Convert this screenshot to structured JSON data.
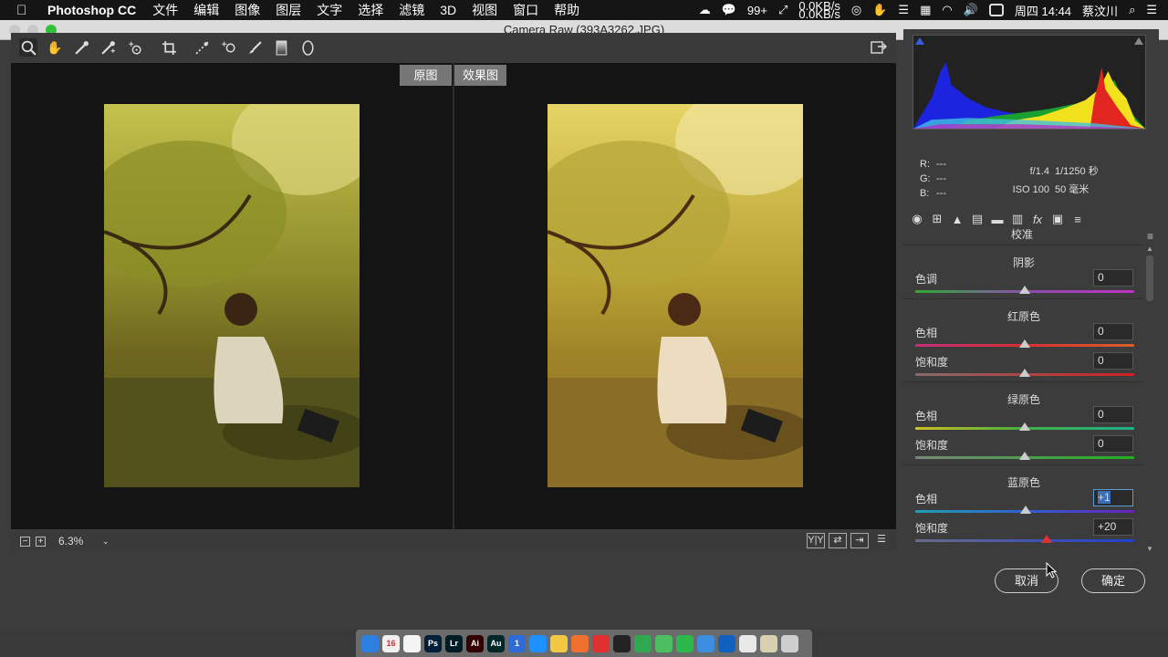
{
  "menubar": {
    "app_name": "Photoshop CC",
    "items": [
      "文件",
      "编辑",
      "图像",
      "图层",
      "文字",
      "选择",
      "滤镜",
      "3D",
      "视图",
      "窗口",
      "帮助"
    ],
    "notifications": "99+",
    "net_up": "0.0KB/s",
    "net_down": "0.0KB/s",
    "clock": "周四 14:44",
    "user": "蔡汶川"
  },
  "window": {
    "title": "Camera Raw (393A3262.JPG)"
  },
  "toolbar": {
    "tools": [
      "zoom-tool",
      "hand-tool",
      "white-balance-tool",
      "color-sampler-tool",
      "targeted-adjustment-tool",
      "crop-tool",
      "straighten-tool",
      "spot-removal-tool",
      "red-eye-tool",
      "adjustment-brush",
      "graduated-filter",
      "radial-filter"
    ]
  },
  "preview": {
    "before_label": "原图",
    "after_label": "效果图",
    "zoom": "6.3%"
  },
  "info": {
    "r_label": "R:",
    "r_value": "---",
    "g_label": "G:",
    "g_value": "---",
    "b_label": "B:",
    "b_value": "---",
    "aperture": "f/1.4",
    "shutter": "1/1250 秒",
    "iso": "ISO 100",
    "focal": "50 毫米"
  },
  "panel": {
    "section": "校准",
    "groups": [
      {
        "title": "阴影",
        "rows": [
          {
            "label": "色调",
            "value": "0",
            "pos": 0.5,
            "grad": "linear-gradient(90deg,#2faa2f,#8b4faf,#c030c0)"
          }
        ]
      },
      {
        "title": "红原色",
        "rows": [
          {
            "label": "色相",
            "value": "0",
            "pos": 0.5,
            "grad": "linear-gradient(90deg,#c0307a,#d83030,#d8602a)"
          },
          {
            "label": "饱和度",
            "value": "0",
            "pos": 0.5,
            "grad": "linear-gradient(90deg,#8a6a6a,#d02020)"
          }
        ]
      },
      {
        "title": "绿原色",
        "rows": [
          {
            "label": "色相",
            "value": "0",
            "pos": 0.5,
            "grad": "linear-gradient(90deg,#d0c020,#40b040,#20b090)"
          },
          {
            "label": "饱和度",
            "value": "0",
            "pos": 0.5,
            "grad": "linear-gradient(90deg,#7a8a7a,#20b020)"
          }
        ]
      },
      {
        "title": "蓝原色",
        "rows": [
          {
            "label": "色相",
            "value": "+1",
            "pos": 0.503,
            "focus": true,
            "grad": "linear-gradient(90deg,#20a0b0,#3060d0,#6a20c0)"
          },
          {
            "label": "饱和度",
            "value": "+20",
            "pos": 0.6,
            "active": true,
            "grad": "linear-gradient(90deg,#6a6a8a,#2040d0)"
          }
        ]
      }
    ]
  },
  "buttons": {
    "cancel": "取消",
    "ok": "确定"
  },
  "dock": {
    "apps": [
      {
        "label": "",
        "color": "#2d7fe0"
      },
      {
        "label": "16",
        "color": "#f0f0f0"
      },
      {
        "label": "",
        "color": "#f4f4f4"
      },
      {
        "label": "Ps",
        "color": "#001e36"
      },
      {
        "label": "Lr",
        "color": "#001d26"
      },
      {
        "label": "Ai",
        "color": "#330000"
      },
      {
        "label": "Au",
        "color": "#00262a"
      },
      {
        "label": "1",
        "color": "#2c6bd8"
      },
      {
        "label": "",
        "color": "#1e90ff"
      },
      {
        "label": "",
        "color": "#f2c744"
      },
      {
        "label": "",
        "color": "#f07030"
      },
      {
        "label": "",
        "color": "#e03030"
      },
      {
        "label": "",
        "color": "#222"
      },
      {
        "label": "",
        "color": "#2fa84f"
      },
      {
        "label": "",
        "color": "#4cc060"
      },
      {
        "label": "",
        "color": "#2db84d"
      },
      {
        "label": "",
        "color": "#3c8ee0"
      },
      {
        "label": "",
        "color": "#1060c0"
      },
      {
        "label": "",
        "color": "#e8e8e8"
      },
      {
        "label": "",
        "color": "#d8d0b0"
      },
      {
        "label": "",
        "color": "#cfcfcf"
      }
    ]
  }
}
